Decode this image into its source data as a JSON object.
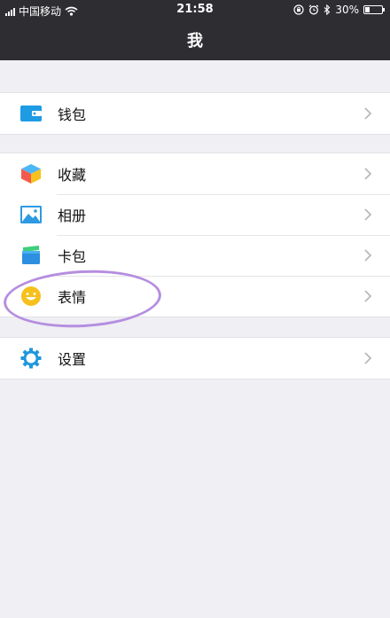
{
  "status_bar": {
    "carrier": "中国移动",
    "time": "21:58",
    "battery_percent": "30%",
    "battery_level": 0.3,
    "icons": [
      "signal-icon",
      "wifi-icon",
      "orientation-lock-icon",
      "alarm-icon",
      "bluetooth-icon",
      "battery-icon"
    ]
  },
  "header": {
    "title": "我"
  },
  "groups": [
    {
      "items": [
        {
          "label": "钱包",
          "icon": "wallet-icon"
        }
      ]
    },
    {
      "items": [
        {
          "label": "收藏",
          "icon": "favorites-cube-icon"
        },
        {
          "label": "相册",
          "icon": "album-picture-icon"
        },
        {
          "label": "卡包",
          "icon": "card-pack-icon"
        },
        {
          "label": "表情",
          "icon": "smiley-face-icon"
        }
      ]
    },
    {
      "items": [
        {
          "label": "设置",
          "icon": "settings-gear-icon"
        }
      ]
    }
  ],
  "colors": {
    "header_bg": "#2e2d32",
    "page_bg": "#efeff4",
    "annotation": "#b58ee0"
  }
}
